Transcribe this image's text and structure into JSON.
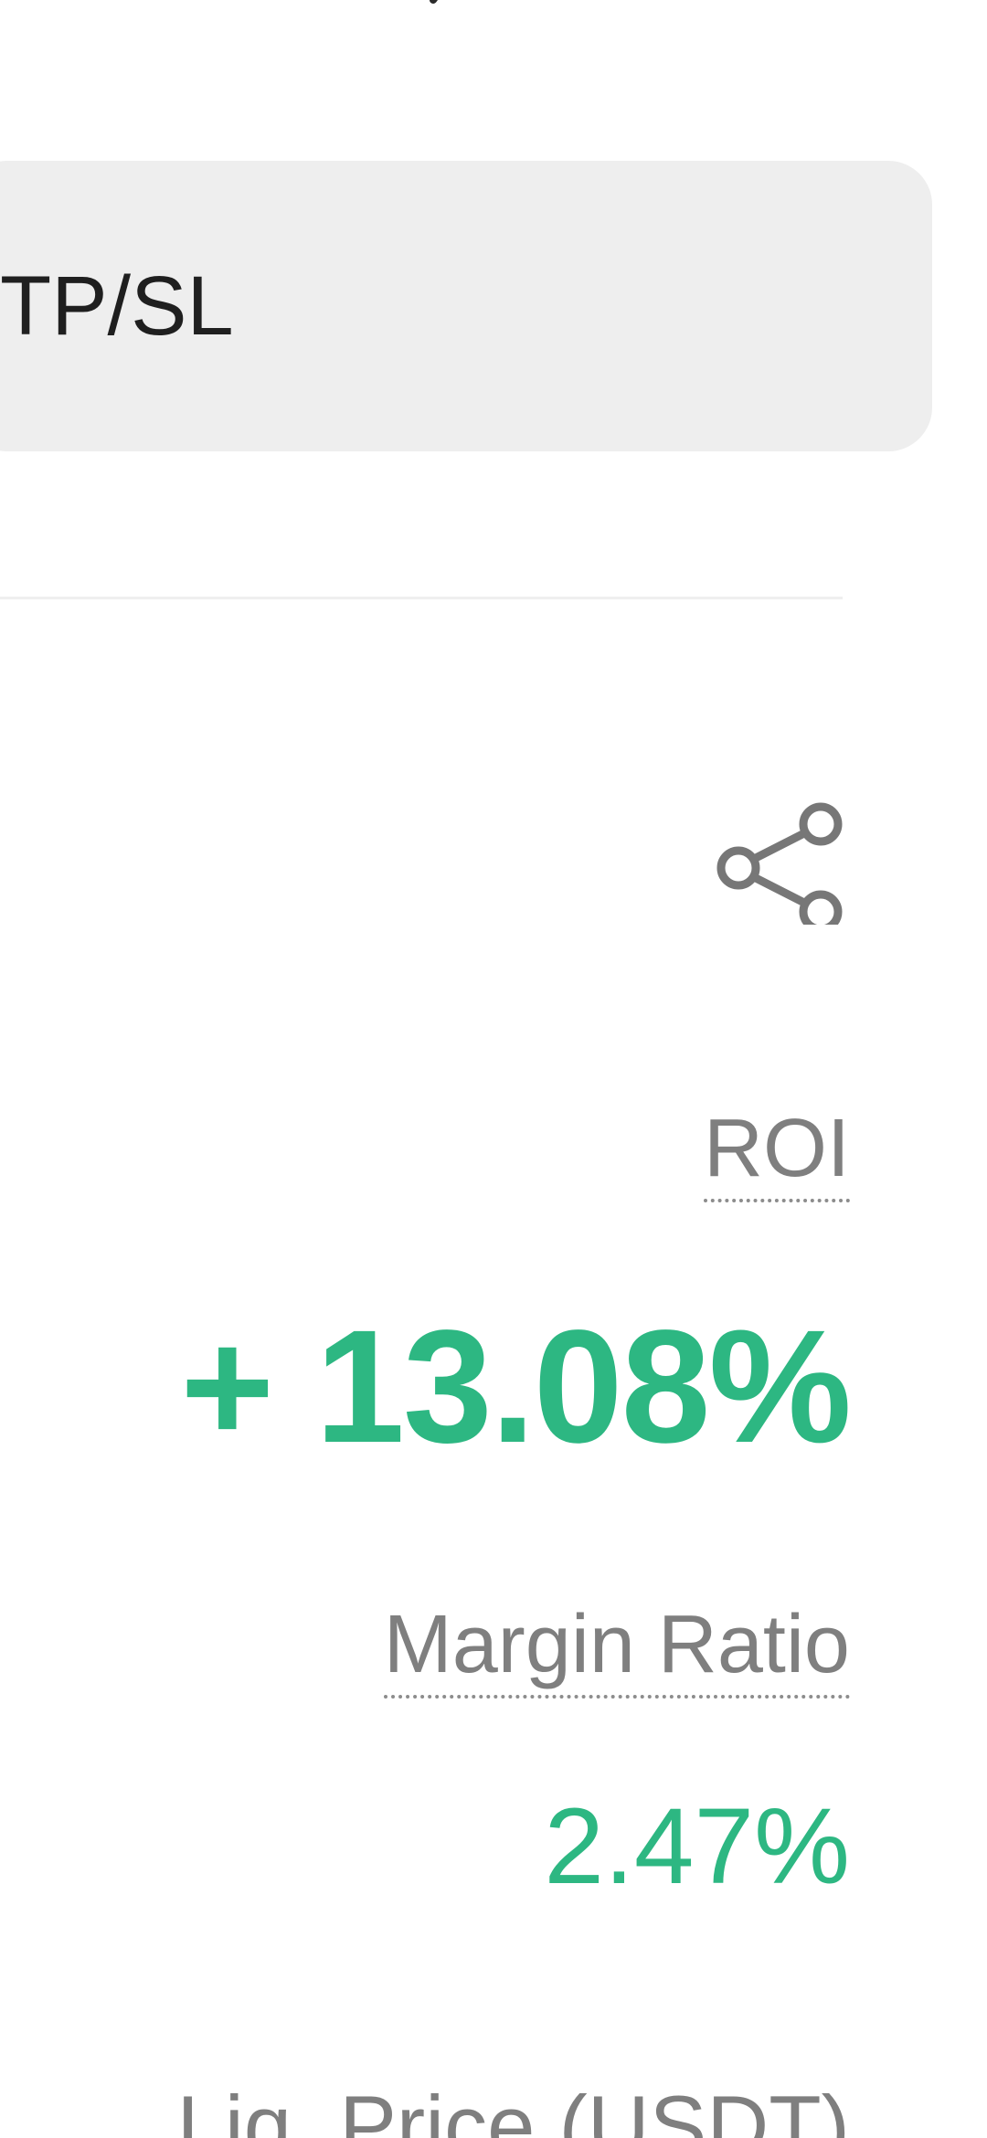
{
  "top_fragment": {
    "icon": "comma-fragment"
  },
  "actions": {
    "tpsl_label": "TP/SL",
    "share_icon": "share-icon"
  },
  "position": {
    "roi_label": "ROI",
    "roi_value": "+ 13.08%",
    "margin_ratio_label": "Margin Ratio",
    "margin_ratio_value": "2.47%",
    "liq_price_label": "Liq. Price (USDT)"
  },
  "colors": {
    "positive": "#2db782",
    "muted_text": "#7f7f7f",
    "button_background": "#eeeeee"
  }
}
